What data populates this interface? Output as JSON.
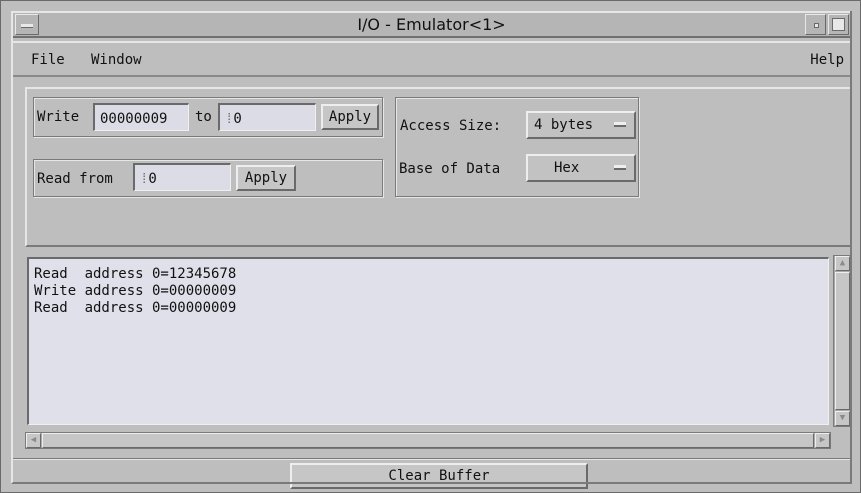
{
  "window": {
    "title": "I/O - Emulator<1>"
  },
  "menubar": {
    "file": "File",
    "window": "Window",
    "help": "Help"
  },
  "write_group": {
    "write_label": "Write",
    "value": "00000009",
    "to_label": "to",
    "address": "0",
    "apply_label": "Apply"
  },
  "read_group": {
    "read_label": "Read from",
    "address": "0",
    "apply_label": "Apply"
  },
  "options": {
    "access_size_label": "Access Size:",
    "access_size_value": "4 bytes",
    "base_label": "Base of Data",
    "base_value": "Hex"
  },
  "output": {
    "lines": [
      "Read  address 0=12345678",
      "Write address 0=00000009",
      "Read  address 0=00000009"
    ]
  },
  "footer": {
    "clear_label": "Clear Buffer"
  }
}
